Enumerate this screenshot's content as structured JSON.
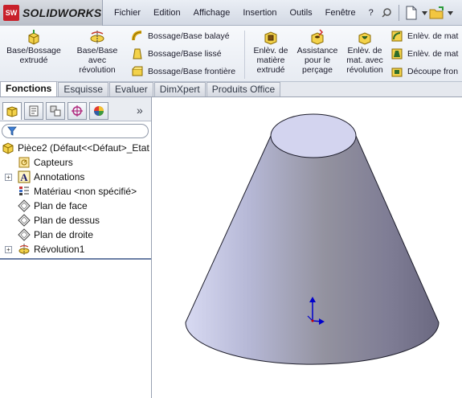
{
  "app": {
    "logo_mark": "SW",
    "name": "SOLIDWORKS"
  },
  "menu": [
    "Fichier",
    "Edition",
    "Affichage",
    "Insertion",
    "Outils",
    "Fenêtre",
    "?"
  ],
  "commands": {
    "extruded_boss": "Base/Bossage\nextrudé",
    "revolved_boss": "Base/Base\navec\nrévolution",
    "swept_boss": "Bossage/Base balayé",
    "lofted_boss": "Bossage/Base lissé",
    "boundary_boss": "Bossage/Base frontière",
    "extruded_cut": "Enlèv. de\nmatière\nextrudé",
    "hole_wizard": "Assistance\npour le\nperçage",
    "revolved_cut": "Enlèv. de\nmat. avec\nrévolution",
    "swept_cut": "Enlèv. de mat",
    "lofted_cut": "Enlèv. de mat",
    "boundary_cut": "Découpe fron"
  },
  "tabs": [
    "Fonctions",
    "Esquisse",
    "Evaluer",
    "DimXpert",
    "Produits Office"
  ],
  "panel": {
    "more": "»"
  },
  "tree": [
    {
      "label": "Pièce2  (Défaut<<Défaut>_Etat",
      "icon": "part-icon",
      "expandable": false
    },
    {
      "label": "Capteurs",
      "icon": "sensors-icon",
      "expandable": false
    },
    {
      "label": "Annotations",
      "icon": "annotations-icon",
      "expandable": true
    },
    {
      "label": "Matériau <non spécifié>",
      "icon": "material-icon",
      "expandable": false
    },
    {
      "label": "Plan de face",
      "icon": "plane-icon",
      "expandable": false
    },
    {
      "label": "Plan de dessus",
      "icon": "plane-icon",
      "expandable": false
    },
    {
      "label": "Plan de droite",
      "icon": "plane-icon",
      "expandable": false
    },
    {
      "label": "Révolution1",
      "icon": "revolve-feature-icon",
      "expandable": true
    }
  ],
  "colors": {
    "accent": "#2f5ea8",
    "cone_light": "#c9ccea",
    "cone_dark": "#6e6b85",
    "triad_blue": "#0000cc"
  }
}
